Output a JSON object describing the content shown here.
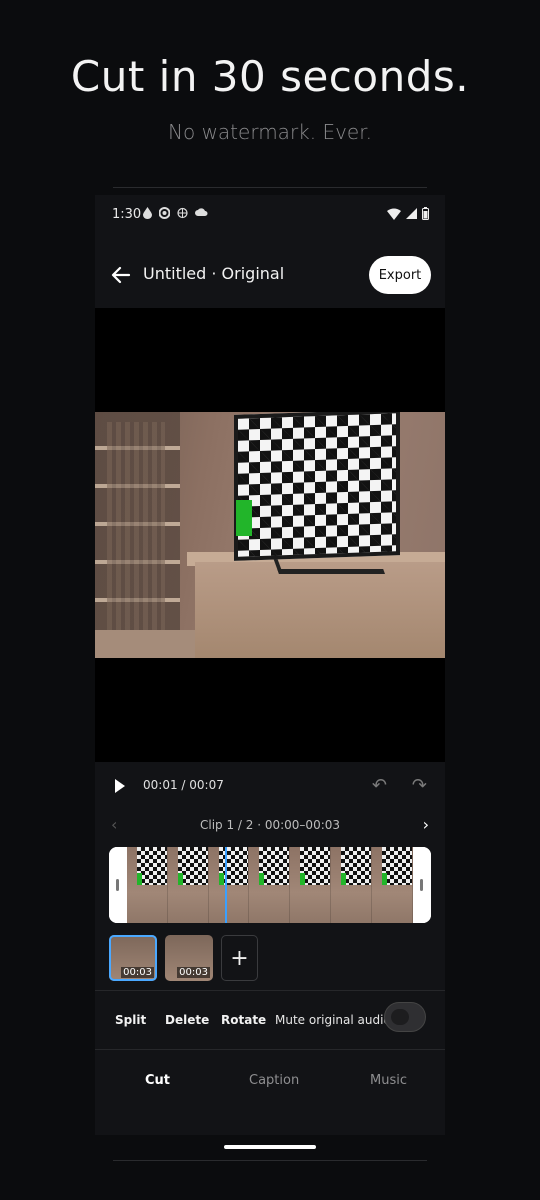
{
  "hero": {
    "title": "Cut in 30 seconds.",
    "subtitle": "No watermark. Ever."
  },
  "status_bar": {
    "time": "1:30",
    "left_icons": [
      "water-drop-icon",
      "face-icon",
      "globe-icon",
      "cloud-icon"
    ],
    "right_icons": [
      "wifi-icon",
      "signal-icon",
      "battery-icon"
    ]
  },
  "topbar": {
    "title": "Untitled · Original",
    "export_label": "Export"
  },
  "playback": {
    "time": "00:01 / 00:07"
  },
  "clip_nav": {
    "label": "Clip 1 / 2 · 00:00–00:03"
  },
  "clips": [
    {
      "duration": "00:03",
      "selected": true
    },
    {
      "duration": "00:03",
      "selected": false
    }
  ],
  "add_clip_label": "+",
  "tools": {
    "split": "Split",
    "delete": "Delete",
    "rotate": "Rotate",
    "mute": "Mute original audio",
    "mute_on": false
  },
  "tabs": [
    "Cut",
    "Caption",
    "Music"
  ],
  "active_tab": "Cut",
  "colors": {
    "accent": "#3aa0ff",
    "background": "#0b0c0e",
    "panel": "#121316",
    "tv_green": "#22b52a"
  }
}
